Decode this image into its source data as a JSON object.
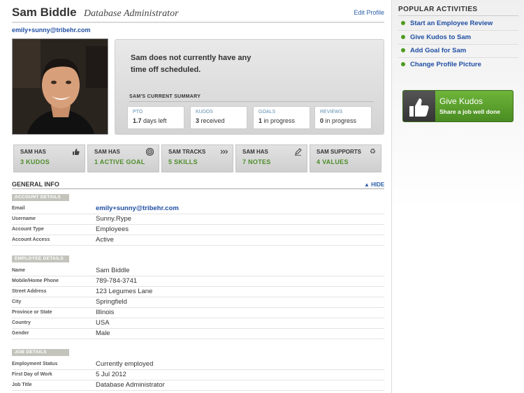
{
  "profile": {
    "name": "Sam Biddle",
    "role": "Database Administrator",
    "edit_label": "Edit Profile",
    "email": "emily+sunny@tribehr.com"
  },
  "summary": {
    "message": "Sam does not currently have any time off scheduled.",
    "title": "SAM'S CURRENT SUMMARY",
    "stats": [
      {
        "label": "PTO",
        "value": "1.7",
        "suffix": "days left"
      },
      {
        "label": "KUDOS",
        "value": "3",
        "suffix": "received"
      },
      {
        "label": "GOALS",
        "value": "1",
        "suffix": "in progress"
      },
      {
        "label": "REVIEWS",
        "value": "0",
        "suffix": "in progress"
      }
    ]
  },
  "tiles": [
    {
      "top": "SAM HAS",
      "bottom": "3 KUDOS",
      "icon": "thumbs-up-icon"
    },
    {
      "top": "SAM HAS",
      "bottom": "1 ACTIVE GOAL",
      "icon": "target-icon"
    },
    {
      "top": "SAM TRACKS",
      "bottom": "5 SKILLS",
      "icon": "chevrons-icon"
    },
    {
      "top": "SAM HAS",
      "bottom": "7 NOTES",
      "icon": "pencil-icon"
    },
    {
      "top": "SAM SUPPORTS",
      "bottom": "4 VALUES",
      "icon": "recycle-icon"
    }
  ],
  "general_info": {
    "title": "GENERAL INFO",
    "hide_label": "HIDE",
    "account_details": {
      "title": "ACCOUNT DETAILS",
      "rows": [
        {
          "label": "Email",
          "value": "emily+sunny@tribehr.com"
        },
        {
          "label": "Username",
          "value": "Sunny.Rype"
        },
        {
          "label": "Account Type",
          "value": "Employees"
        },
        {
          "label": "Account Access",
          "value": "Active"
        }
      ]
    },
    "employee_details": {
      "title": "EMPLOYEE DETAILS",
      "rows": [
        {
          "label": "Name",
          "value": "Sam Biddle"
        },
        {
          "label": "Mobile/Home Phone",
          "value": "789-784-3741"
        },
        {
          "label": "Street Address",
          "value": "123 Legumes Lane"
        },
        {
          "label": "City",
          "value": "Springfield"
        },
        {
          "label": "Province or State",
          "value": "Illinois"
        },
        {
          "label": "Country",
          "value": "USA"
        },
        {
          "label": "Gender",
          "value": "Male"
        }
      ]
    },
    "job_details": {
      "title": "JOB DETAILS",
      "rows": [
        {
          "label": "Employment Status",
          "value": "Currently employed"
        },
        {
          "label": "First Day of Work",
          "value": "5 Jul 2012"
        },
        {
          "label": "Job Title",
          "value": "Database Administrator"
        }
      ]
    }
  },
  "popular_activities": {
    "title": "POPULAR ACTIVITIES",
    "items": [
      "Start an Employee Review",
      "Give Kudos to Sam",
      "Add Goal for Sam",
      "Change Profile Picture"
    ]
  },
  "kudos_button": {
    "title": "Give Kudos",
    "subtitle": "Share a job well done"
  }
}
